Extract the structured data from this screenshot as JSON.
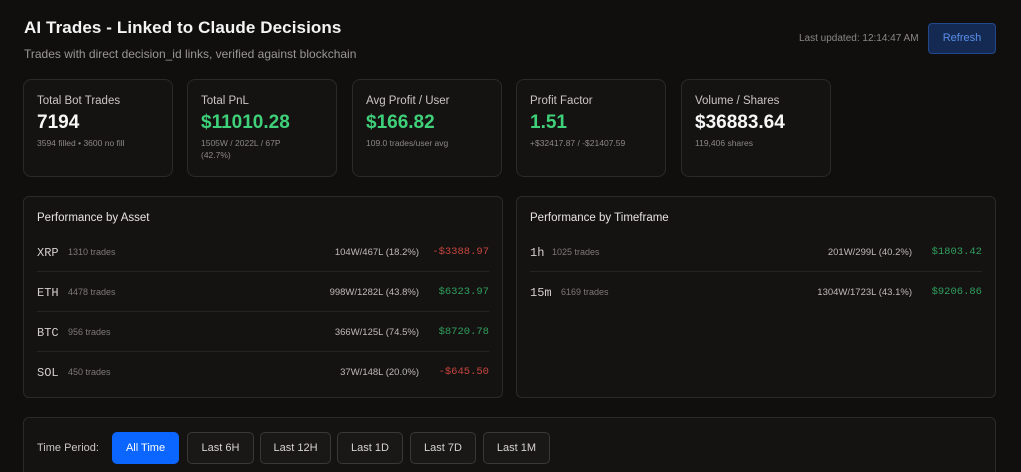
{
  "header": {
    "title": "AI Trades - Linked to Claude Decisions",
    "subtitle": "Trades with direct decision_id links, verified against blockchain",
    "last_updated": "Last updated: 12:14:47 AM",
    "refresh_label": "Refresh"
  },
  "cards": [
    {
      "label": "Total Bot Trades",
      "value": "7194",
      "sub": "3594 filled • 3600 no fill",
      "value_color": "white"
    },
    {
      "label": "Total PnL",
      "value": "$11010.28",
      "sub": "1505W / 2022L / 67P (42.7%)",
      "value_color": "green"
    },
    {
      "label": "Avg Profit / User",
      "value": "$166.82",
      "sub": "109.0 trades/user avg",
      "value_color": "green"
    },
    {
      "label": "Profit Factor",
      "value": "1.51",
      "sub": "+$32417.87 / -$21407.59",
      "value_color": "green"
    },
    {
      "label": "Volume / Shares",
      "value": "$36883.64",
      "sub": "119,406 shares",
      "value_color": "white"
    }
  ],
  "asset_panel": {
    "title": "Performance by Asset",
    "rows": [
      {
        "name": "XRP",
        "count": "1310 trades",
        "wl": "104W/467L (18.2%)",
        "pnl": "-$3388.97",
        "sign": "neg"
      },
      {
        "name": "ETH",
        "count": "4478 trades",
        "wl": "998W/1282L (43.8%)",
        "pnl": "$6323.97",
        "sign": "pos"
      },
      {
        "name": "BTC",
        "count": "956 trades",
        "wl": "366W/125L (74.5%)",
        "pnl": "$8720.78",
        "sign": "pos"
      },
      {
        "name": "SOL",
        "count": "450 trades",
        "wl": "37W/148L (20.0%)",
        "pnl": "-$645.50",
        "sign": "neg"
      }
    ]
  },
  "timeframe_panel": {
    "title": "Performance by Timeframe",
    "rows": [
      {
        "name": "1h",
        "count": "1025 trades",
        "wl": "201W/299L (40.2%)",
        "pnl": "$1803.42",
        "sign": "pos"
      },
      {
        "name": "15m",
        "count": "6169 trades",
        "wl": "1304W/1723L (43.1%)",
        "pnl": "$9206.86",
        "sign": "pos"
      }
    ]
  },
  "filter": {
    "label": "Time Period:",
    "options": [
      "All Time",
      "Last 6H",
      "Last 12H",
      "Last 1D",
      "Last 7D",
      "Last 1M"
    ],
    "selected": "All Time"
  },
  "colors": {
    "positive": "#2f9e5d",
    "negative": "#c7453e",
    "accent": "#0b66ff",
    "card_value_green": "#3fd07a"
  }
}
